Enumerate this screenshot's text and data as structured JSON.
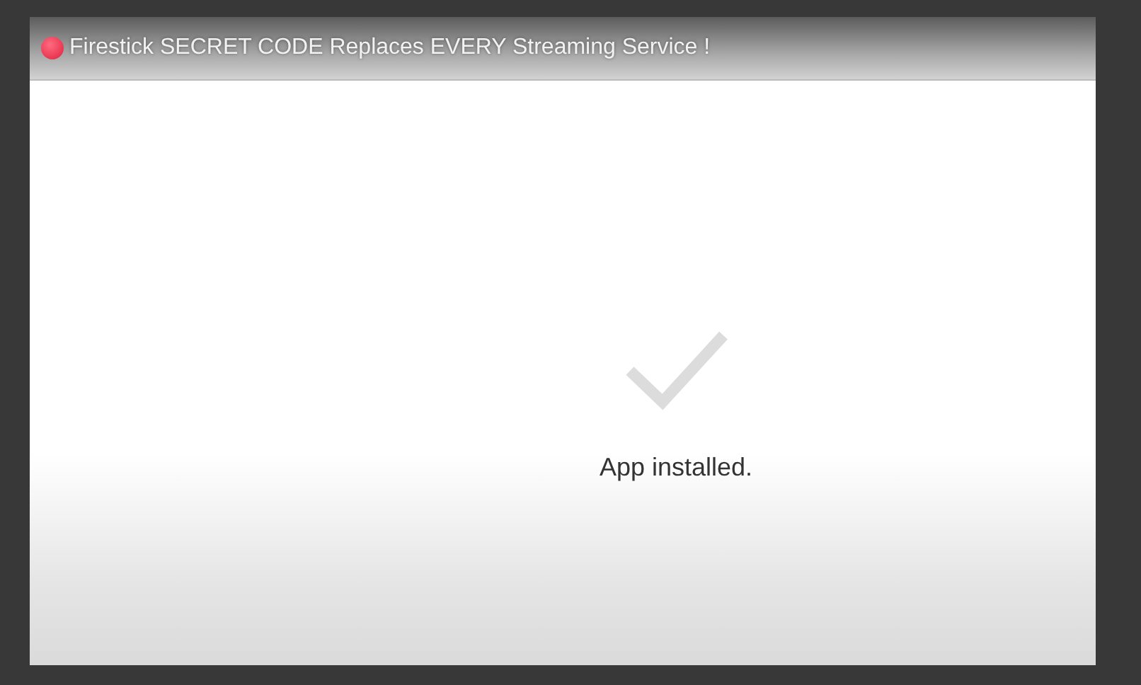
{
  "video": {
    "title": "Firestick SECRET CODE Replaces EVERY Streaming Service !"
  },
  "screen": {
    "message": "App installed."
  }
}
